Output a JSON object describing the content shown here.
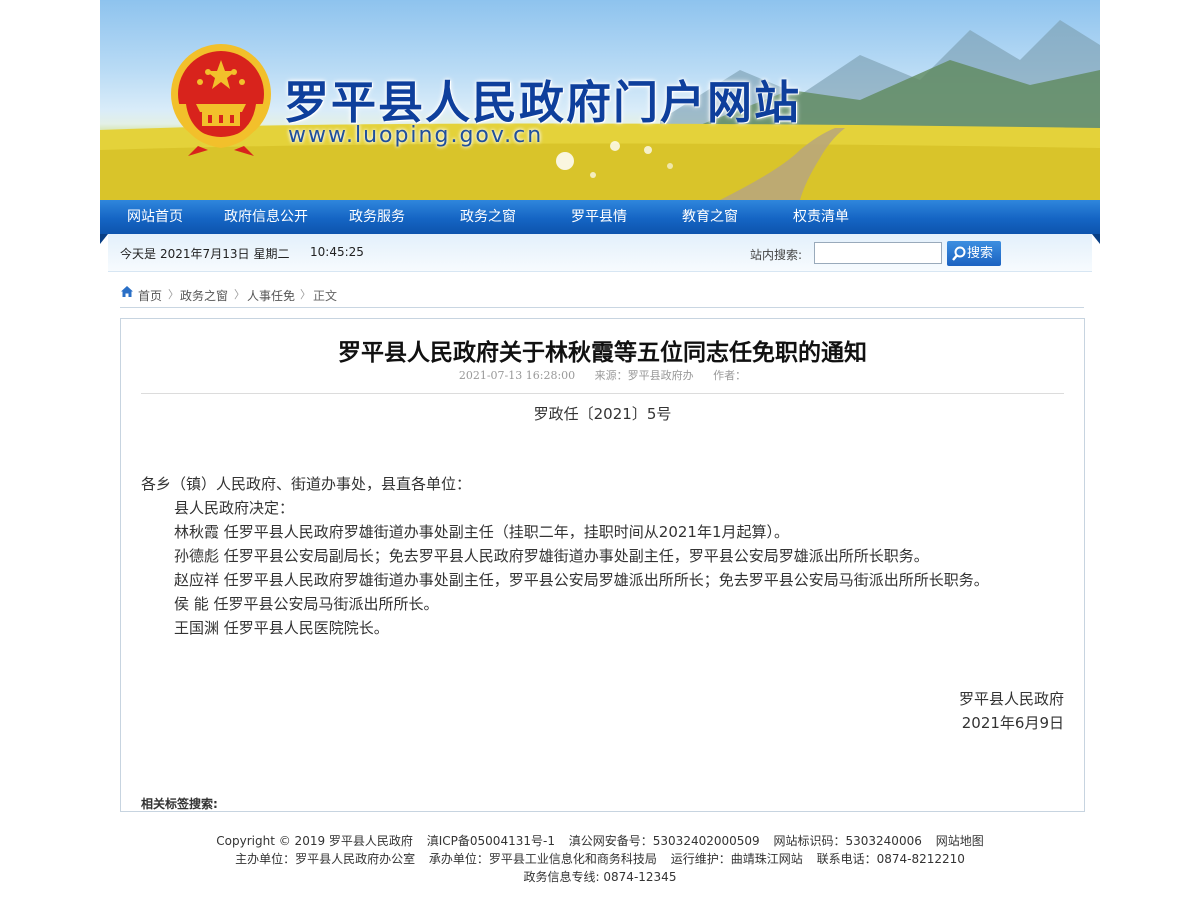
{
  "header": {
    "site_title": "罗平县人民政府门户网站",
    "site_url": "www.luoping.gov.cn"
  },
  "nav": {
    "items": [
      "网站首页",
      "政府信息公开",
      "政务服务",
      "政务之窗",
      "罗平县情",
      "教育之窗",
      "权责清单"
    ]
  },
  "infobar": {
    "date_prefix": "今天是",
    "date": "2021年7月13日",
    "weekday": "星期二",
    "time": "10:45:25",
    "search_label": "站内搜索:",
    "search_value": "",
    "search_button": "搜索"
  },
  "breadcrumb": {
    "items": [
      "首页",
      "政务之窗",
      "人事任免"
    ],
    "current": "正文"
  },
  "article": {
    "title": "罗平县人民政府关于林秋霞等五位同志任免职的通知",
    "meta": {
      "datetime": "2021-07-13 16:28:00",
      "source": "来源：罗平县政府办",
      "author": "作者："
    },
    "doc_number": "罗政任〔2021〕5号",
    "addressee": "各乡（镇）人民政府、街道办事处，县直各单位：",
    "paragraphs": [
      "县人民政府决定：",
      "林秋霞  任罗平县人民政府罗雄街道办事处副主任（挂职二年，挂职时间从2021年1月起算）。",
      "孙德彪  任罗平县公安局副局长；免去罗平县人民政府罗雄街道办事处副主任，罗平县公安局罗雄派出所所长职务。",
      "赵应祥  任罗平县人民政府罗雄街道办事处副主任，罗平县公安局罗雄派出所所长；免去罗平县公安局马街派出所所长职务。",
      "侯    能  任罗平县公安局马街派出所所长。",
      "王国渊  任罗平县人民医院院长。"
    ],
    "sign_org": "罗平县人民政府",
    "sign_date": "2021年6月9日",
    "tags_label": "相关标签搜索:"
  },
  "footer": {
    "line1": [
      "Copyright © 2019 罗平县人民政府",
      "滇ICP备05004131号-1",
      "滇公网安备号：53032402000509",
      "网站标识码：5303240006",
      "网站地图"
    ],
    "line2": [
      "主办单位：罗平县人民政府办公室",
      "承办单位：罗平县工业信息化和商务科技局",
      "运行维护：曲靖珠江网站",
      "联系电话：0874-8212210"
    ],
    "line3": "政务信息专线: 0874-12345"
  },
  "colors": {
    "nav_blue": "#1565c4",
    "title_blue": "#0e3f9c",
    "emblem_red": "#d8231c",
    "emblem_gold": "#f2c02b"
  }
}
